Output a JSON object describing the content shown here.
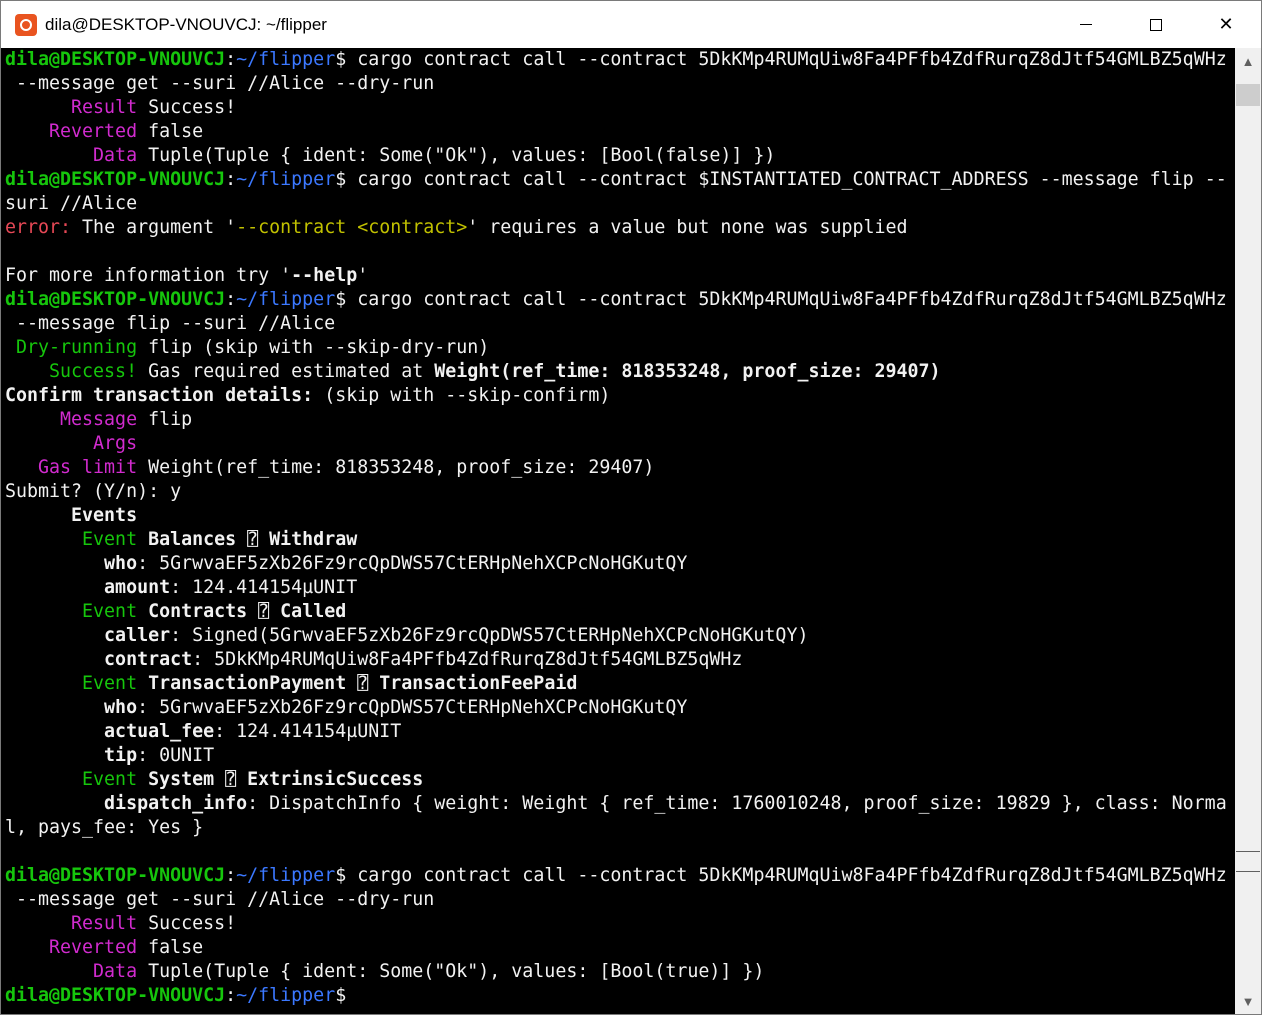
{
  "window": {
    "title": "dila@DESKTOP-VNOUVCJ: ~/flipper",
    "minimize_glyph": "",
    "maximize_glyph": "",
    "close_glyph": "✕"
  },
  "scrollbar": {
    "up_glyph": "▲",
    "down_glyph": "▼"
  },
  "prompt": {
    "user_host": "dila@DESKTOP-VNOUVCJ",
    "colon": ":",
    "path": "~/flipper",
    "dollar": "$"
  },
  "lines": [
    [
      {
        "t": "dila@DESKTOP-VNOUVCJ",
        "c": "gb"
      },
      {
        "t": ":",
        "c": "w"
      },
      {
        "t": "~/flipper",
        "c": "b"
      },
      {
        "t": "$ cargo contract call --contract 5DkKMp4RUMqUiw8Fa4PFfb4ZdfRurqZ8dJtf54GMLBZ5qWHz",
        "c": "w"
      }
    ],
    [
      {
        "t": " --message get --suri //Alice --dry-run",
        "c": "w"
      }
    ],
    [
      {
        "t": "      Result",
        "c": "m"
      },
      {
        "t": " Success!",
        "c": "w"
      }
    ],
    [
      {
        "t": "    Reverted",
        "c": "m"
      },
      {
        "t": " false",
        "c": "w"
      }
    ],
    [
      {
        "t": "        Data",
        "c": "m"
      },
      {
        "t": " Tuple(Tuple { ident: Some(\"Ok\"), values: [Bool(false)] })",
        "c": "w"
      }
    ],
    [
      {
        "t": "dila@DESKTOP-VNOUVCJ",
        "c": "gb"
      },
      {
        "t": ":",
        "c": "w"
      },
      {
        "t": "~/flipper",
        "c": "b"
      },
      {
        "t": "$ cargo contract call --contract $INSTANTIATED_CONTRACT_ADDRESS --message flip --",
        "c": "w"
      }
    ],
    [
      {
        "t": "suri //Alice",
        "c": "w"
      }
    ],
    [
      {
        "t": "error:",
        "c": "r"
      },
      {
        "t": " The argument '",
        "c": "w"
      },
      {
        "t": "--contract <contract>",
        "c": "y"
      },
      {
        "t": "' requires a value but none was supplied",
        "c": "w"
      }
    ],
    [
      {
        "t": "",
        "c": "w"
      }
    ],
    [
      {
        "t": "For more information try '",
        "c": "w"
      },
      {
        "t": "--help",
        "c": "wb"
      },
      {
        "t": "'",
        "c": "w"
      }
    ],
    [
      {
        "t": "dila@DESKTOP-VNOUVCJ",
        "c": "gb"
      },
      {
        "t": ":",
        "c": "w"
      },
      {
        "t": "~/flipper",
        "c": "b"
      },
      {
        "t": "$ cargo contract call --contract 5DkKMp4RUMqUiw8Fa4PFfb4ZdfRurqZ8dJtf54GMLBZ5qWHz",
        "c": "w"
      }
    ],
    [
      {
        "t": " --message flip --suri //Alice",
        "c": "w"
      }
    ],
    [
      {
        "t": " Dry-running",
        "c": "g"
      },
      {
        "t": " flip (skip with --skip-dry-run)",
        "c": "w"
      }
    ],
    [
      {
        "t": "    Success!",
        "c": "g"
      },
      {
        "t": " Gas required estimated at ",
        "c": "w"
      },
      {
        "t": "Weight(ref_time: 818353248, proof_size: 29407)",
        "c": "wb"
      }
    ],
    [
      {
        "t": "Confirm transaction details:",
        "c": "wb"
      },
      {
        "t": " (skip with --skip-confirm)",
        "c": "w"
      }
    ],
    [
      {
        "t": "     Message",
        "c": "m"
      },
      {
        "t": " flip",
        "c": "w"
      }
    ],
    [
      {
        "t": "        Args",
        "c": "m"
      }
    ],
    [
      {
        "t": "   Gas limit",
        "c": "m"
      },
      {
        "t": " Weight(ref_time: 818353248, proof_size: 29407)",
        "c": "w"
      }
    ],
    [
      {
        "t": "Submit? (Y/n): y",
        "c": "w"
      }
    ],
    [
      {
        "t": "      Events",
        "c": "wb"
      }
    ],
    [
      {
        "t": "       Event",
        "c": "g"
      },
      {
        "t": " Balances ",
        "c": "wb"
      },
      {
        "t": "⍰",
        "c": "w"
      },
      {
        "t": " Withdraw",
        "c": "wb"
      }
    ],
    [
      {
        "t": "         who",
        "c": "wb"
      },
      {
        "t": ": 5GrwvaEF5zXb26Fz9rcQpDWS57CtERHpNehXCPcNoHGKutQY",
        "c": "w"
      }
    ],
    [
      {
        "t": "         amount",
        "c": "wb"
      },
      {
        "t": ": 124.414154µUNIT",
        "c": "w"
      }
    ],
    [
      {
        "t": "       Event",
        "c": "g"
      },
      {
        "t": " Contracts ",
        "c": "wb"
      },
      {
        "t": "⍰",
        "c": "w"
      },
      {
        "t": " Called",
        "c": "wb"
      }
    ],
    [
      {
        "t": "         caller",
        "c": "wb"
      },
      {
        "t": ": Signed(5GrwvaEF5zXb26Fz9rcQpDWS57CtERHpNehXCPcNoHGKutQY)",
        "c": "w"
      }
    ],
    [
      {
        "t": "         contract",
        "c": "wb"
      },
      {
        "t": ": 5DkKMp4RUMqUiw8Fa4PFfb4ZdfRurqZ8dJtf54GMLBZ5qWHz",
        "c": "w"
      }
    ],
    [
      {
        "t": "       Event",
        "c": "g"
      },
      {
        "t": " TransactionPayment ",
        "c": "wb"
      },
      {
        "t": "⍰",
        "c": "w"
      },
      {
        "t": " TransactionFeePaid",
        "c": "wb"
      }
    ],
    [
      {
        "t": "         who",
        "c": "wb"
      },
      {
        "t": ": 5GrwvaEF5zXb26Fz9rcQpDWS57CtERHpNehXCPcNoHGKutQY",
        "c": "w"
      }
    ],
    [
      {
        "t": "         actual_fee",
        "c": "wb"
      },
      {
        "t": ": 124.414154µUNIT",
        "c": "w"
      }
    ],
    [
      {
        "t": "         tip",
        "c": "wb"
      },
      {
        "t": ": 0UNIT",
        "c": "w"
      }
    ],
    [
      {
        "t": "       Event",
        "c": "g"
      },
      {
        "t": " System ",
        "c": "wb"
      },
      {
        "t": "⍰",
        "c": "w"
      },
      {
        "t": " ExtrinsicSuccess",
        "c": "wb"
      }
    ],
    [
      {
        "t": "         dispatch_info",
        "c": "wb"
      },
      {
        "t": ": DispatchInfo { weight: Weight { ref_time: 1760010248, proof_size: 19829 }, class: Norma",
        "c": "w"
      }
    ],
    [
      {
        "t": "l, pays_fee: Yes }",
        "c": "w"
      }
    ],
    [
      {
        "t": "",
        "c": "w"
      }
    ],
    [
      {
        "t": "dila@DESKTOP-VNOUVCJ",
        "c": "gb"
      },
      {
        "t": ":",
        "c": "w"
      },
      {
        "t": "~/flipper",
        "c": "b"
      },
      {
        "t": "$ cargo contract call --contract 5DkKMp4RUMqUiw8Fa4PFfb4ZdfRurqZ8dJtf54GMLBZ5qWHz",
        "c": "w"
      }
    ],
    [
      {
        "t": " --message get --suri //Alice --dry-run",
        "c": "w"
      }
    ],
    [
      {
        "t": "      Result",
        "c": "m"
      },
      {
        "t": " Success!",
        "c": "w"
      }
    ],
    [
      {
        "t": "    Reverted",
        "c": "m"
      },
      {
        "t": " false",
        "c": "w"
      }
    ],
    [
      {
        "t": "        Data",
        "c": "m"
      },
      {
        "t": " Tuple(Tuple { ident: Some(\"Ok\"), values: [Bool(true)] })",
        "c": "w"
      }
    ],
    [
      {
        "t": "dila@DESKTOP-VNOUVCJ",
        "c": "gb"
      },
      {
        "t": ":",
        "c": "w"
      },
      {
        "t": "~/flipper",
        "c": "b"
      },
      {
        "t": "$",
        "c": "w"
      }
    ]
  ]
}
